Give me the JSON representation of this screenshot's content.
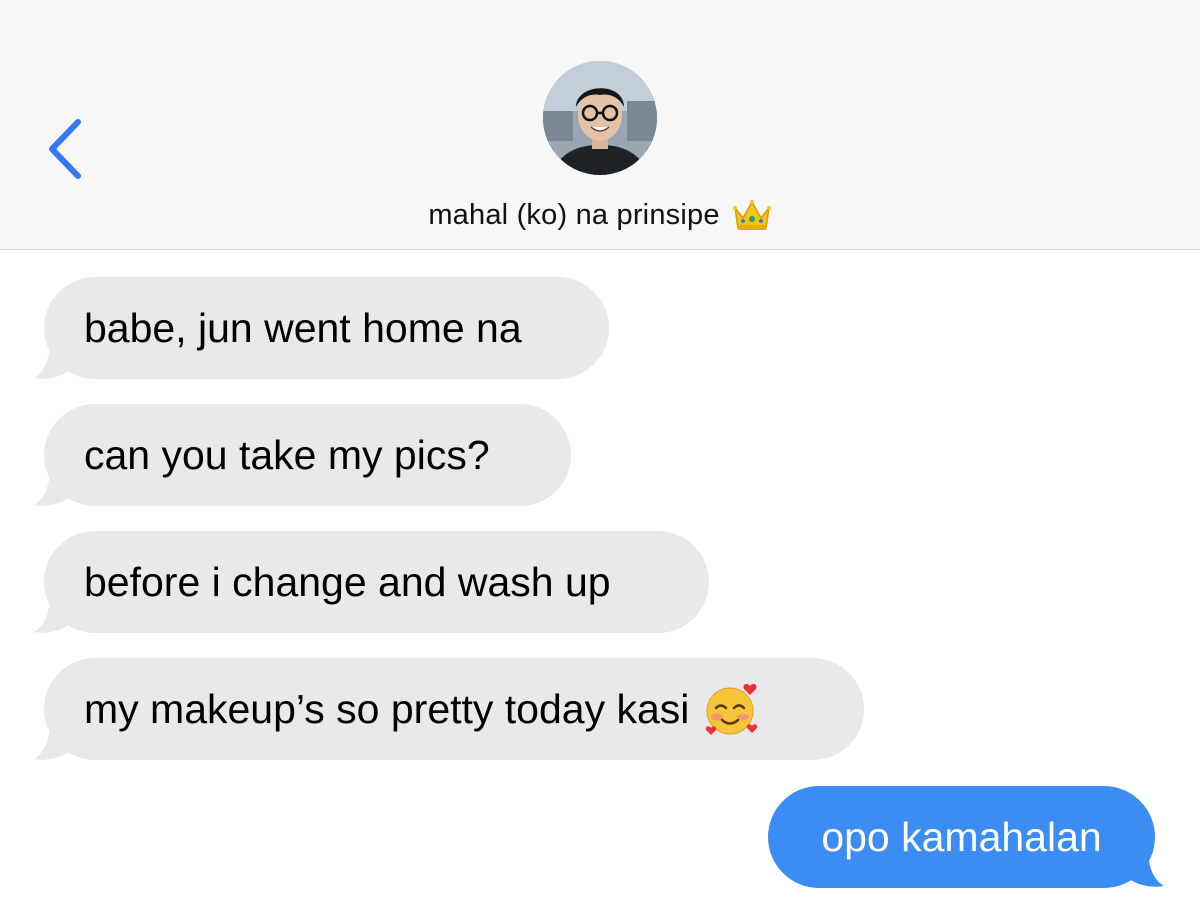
{
  "header": {
    "contact_name": "mahal (ko) na prinsipe",
    "name_emoji": "crown-emoji",
    "avatar": "contact-avatar-photo",
    "back_icon": "chevron-left-icon"
  },
  "messages": [
    {
      "direction": "received",
      "text": "babe, jun went home na"
    },
    {
      "direction": "received",
      "text": "can you take my pics?"
    },
    {
      "direction": "received",
      "text": "before i change and wash up"
    },
    {
      "direction": "received",
      "text": "my makeup’s so pretty today kasi",
      "emoji": "smiling-face-with-hearts-emoji"
    },
    {
      "direction": "sent",
      "text": "opo kamahalan"
    }
  ],
  "colors": {
    "header_bg": "#f7f7f7",
    "received_bubble": "#e9e9eb",
    "sent_bubble": "#3b8cf3",
    "accent": "#3478f6"
  }
}
